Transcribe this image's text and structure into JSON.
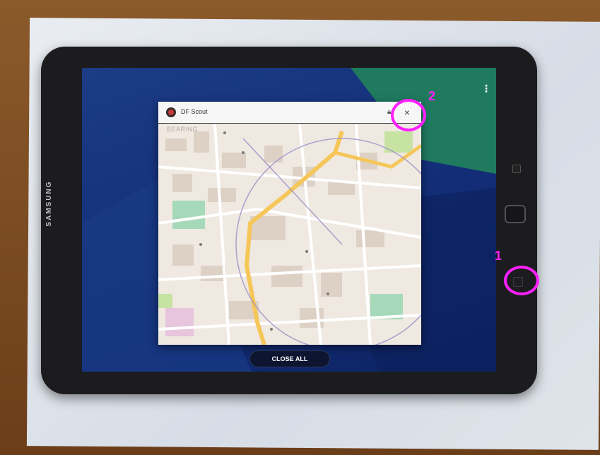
{
  "device": {
    "brand": "SAMSUNG"
  },
  "recent_apps": {
    "menu_icon": "more-vert-icon",
    "card": {
      "app_title": "DF Scout",
      "app_icon": "df-scout-logo-icon",
      "pin_icon": "lock-icon",
      "close_icon": "close-icon",
      "close_glyph": "×",
      "map_label": "BEARING"
    },
    "close_all_label": "CLOSE ALL"
  },
  "annotations": {
    "step_1": "1",
    "step_2": "2",
    "color": "#ff20ff"
  },
  "colors": {
    "wallpaper": "#14307a",
    "wallpaper_accent": "#1f7a5e",
    "road_major": "#f5c659",
    "park": "#a6d9b9"
  }
}
